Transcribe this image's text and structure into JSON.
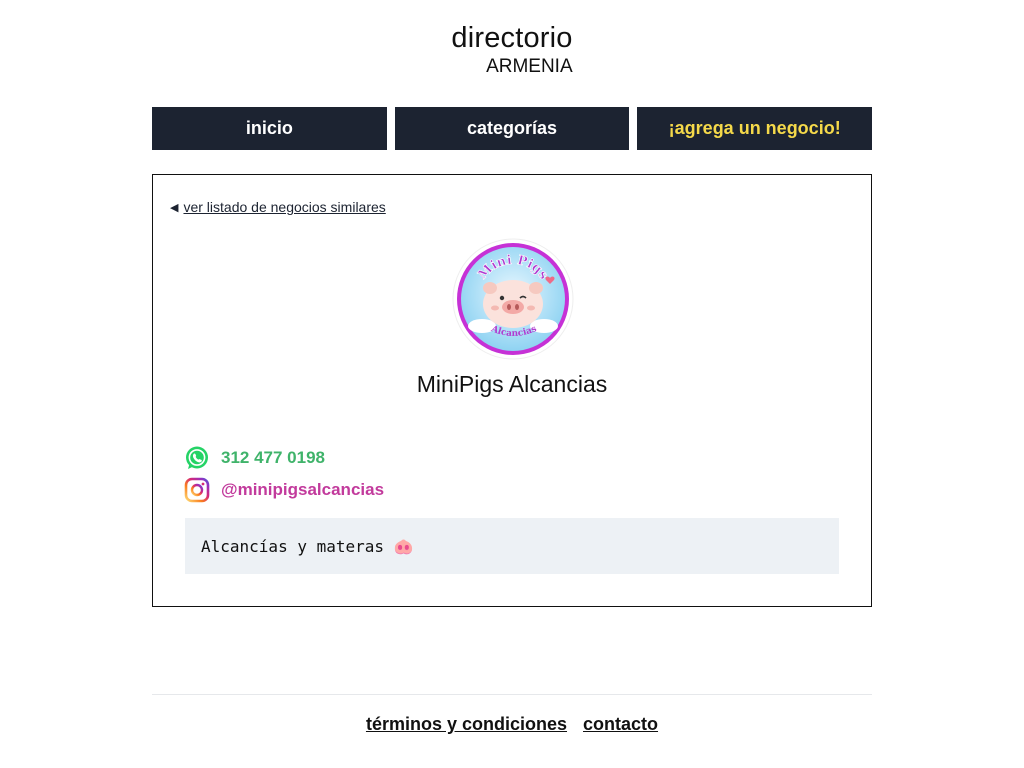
{
  "header": {
    "title": "directorio",
    "subtitle": "ARMENIA"
  },
  "nav": {
    "items": [
      {
        "label": "inicio"
      },
      {
        "label": "categorías"
      },
      {
        "label": "¡agrega un negocio!"
      }
    ],
    "accent_color": "#f5d94a",
    "bg_color": "#1c2331"
  },
  "listing": {
    "back_link": "ver listado de negocios similares",
    "avatar": {
      "logo_line1": "Mini Pigs",
      "logo_line2": "Alcancias"
    },
    "name": "MiniPigs Alcancias",
    "whatsapp": {
      "icon": "whatsapp-icon",
      "value": "312 477 0198",
      "color": "#3fb36a"
    },
    "instagram": {
      "icon": "instagram-icon",
      "value": "@minipigsalcancias",
      "color": "#c23a9c"
    },
    "description": "Alcancías y materas 🐽"
  },
  "footer": {
    "links": [
      {
        "label": "términos y condiciones"
      },
      {
        "label": "contacto"
      }
    ]
  }
}
